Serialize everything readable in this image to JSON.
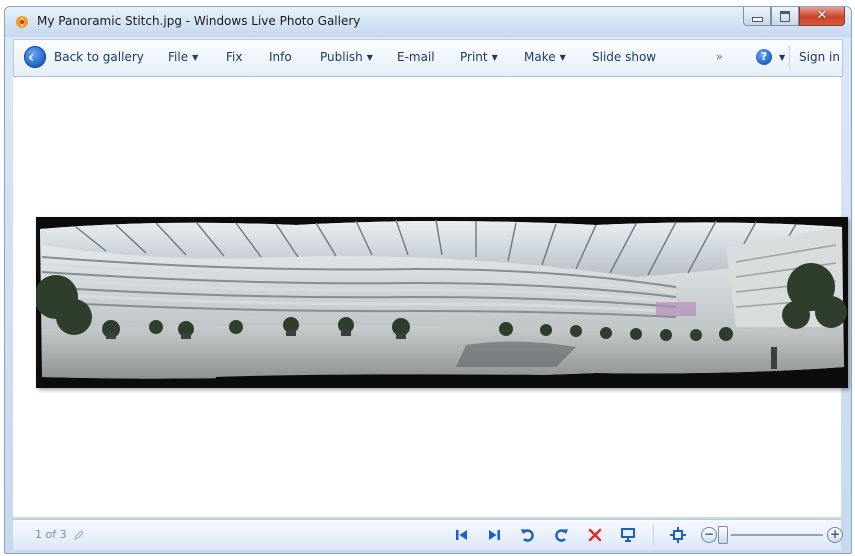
{
  "window": {
    "title": "My Panoramic Stitch.jpg - Windows Live Photo Gallery",
    "close_glyph": "✕"
  },
  "toolbar": {
    "back_label": "Back to gallery",
    "file_label": "File",
    "fix_label": "Fix",
    "info_label": "Info",
    "publish_label": "Publish",
    "email_label": "E-mail",
    "print_label": "Print",
    "make_label": "Make",
    "slideshow_label": "Slide show",
    "overflow_label": "»",
    "help_label": "?",
    "signin_label": "Sign in"
  },
  "status": {
    "position_text": "1 of 3"
  },
  "icons": {
    "back": "arrow-left-icon",
    "help": "help-icon",
    "first": "skip-to-start-icon",
    "last": "skip-to-end-icon",
    "rotate_ccw": "rotate-counterclockwise-icon",
    "rotate_cw": "rotate-clockwise-icon",
    "delete": "delete-x-icon",
    "slideshow": "slideshow-icon",
    "actual_size": "actual-size-icon",
    "zoom_out": "zoom-out-icon",
    "zoom_in": "zoom-in-icon"
  },
  "zoom": {
    "level_fraction": 0.0
  },
  "colors": {
    "accent": "#1a5fc5",
    "delete_red": "#d8322a",
    "toolbar_text": "#1e395b",
    "frame_background": "#0c0c0c"
  }
}
